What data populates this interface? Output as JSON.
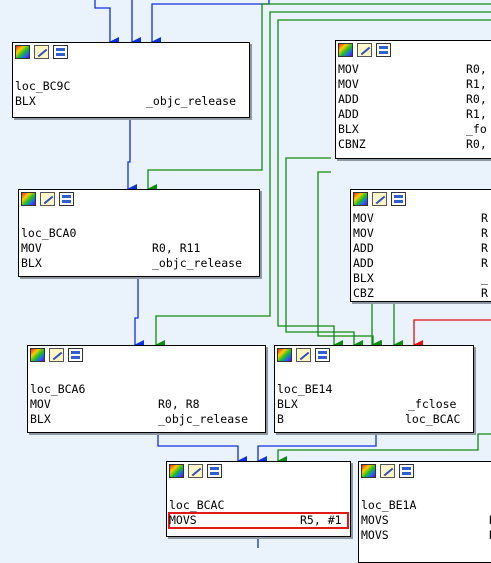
{
  "nodes": {
    "bc9c": {
      "label": "loc_BC9C",
      "rows": [
        {
          "mn": "BLX",
          "op": "_objc_release"
        }
      ]
    },
    "bca0": {
      "label": "loc_BCA0",
      "rows": [
        {
          "mn": "MOV",
          "op": "R0, R11"
        },
        {
          "mn": "BLX",
          "op": "_objc_release"
        }
      ]
    },
    "bca6": {
      "label": "loc_BCA6",
      "rows": [
        {
          "mn": "MOV",
          "op": "R0, R8"
        },
        {
          "mn": "BLX",
          "op": "_objc_release"
        }
      ]
    },
    "be14": {
      "label": "loc_BE14",
      "rows": [
        {
          "mn": "BLX",
          "op": "_fclose"
        },
        {
          "mn": "B",
          "op": "loc_BCAC"
        }
      ]
    },
    "bcac": {
      "label": "loc_BCAC",
      "rows": [
        {
          "mn": "MOVS",
          "op": "R5, #1"
        }
      ]
    },
    "be1a": {
      "label": "loc_BE1A",
      "rows": [
        {
          "mn": "MOVS",
          "op": "R"
        },
        {
          "mn": "MOVS",
          "op": "R"
        }
      ]
    },
    "top_right": {
      "rows": [
        {
          "mn": "MOV",
          "op": "R0,"
        },
        {
          "mn": "MOV",
          "op": "R1,"
        },
        {
          "mn": "ADD",
          "op": "R0,"
        },
        {
          "mn": "ADD",
          "op": "R1,"
        },
        {
          "mn": "BLX",
          "op": "_fo"
        },
        {
          "mn": "CBNZ",
          "op": "R0,"
        }
      ]
    },
    "mid_right": {
      "rows": [
        {
          "mn": "MOV",
          "op": "R"
        },
        {
          "mn": "MOV",
          "op": "R"
        },
        {
          "mn": "ADD",
          "op": "R"
        },
        {
          "mn": "ADD",
          "op": "R"
        },
        {
          "mn": "BLX",
          "op": "_"
        },
        {
          "mn": "CBZ",
          "op": "R"
        }
      ]
    }
  },
  "colors": {
    "background": "#eaf3fb",
    "edge_blue": "#1030e0",
    "edge_green": "#108a10",
    "edge_red": "#e01010",
    "highlight": "#e01818"
  },
  "icons": [
    "palette-icon",
    "rename-icon",
    "graph-overview-icon"
  ]
}
